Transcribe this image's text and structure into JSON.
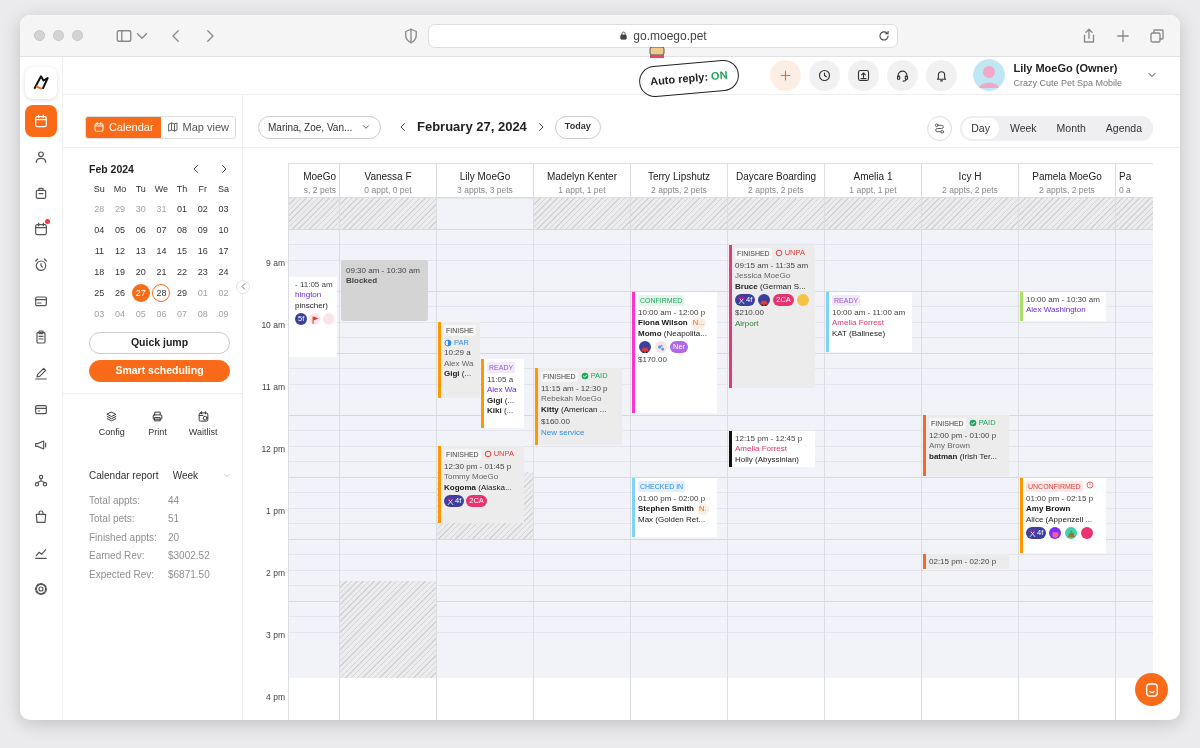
{
  "browser": {
    "url": "go.moego.pet"
  },
  "nav": {
    "items": [
      {
        "selected": true,
        "alert": false
      },
      {
        "selected": false,
        "alert": false
      },
      {
        "selected": false,
        "alert": false
      },
      {
        "selected": false,
        "alert": true
      },
      {
        "selected": false,
        "alert": false
      },
      {
        "selected": false,
        "alert": false
      },
      {
        "selected": false,
        "alert": false
      },
      {
        "selected": false,
        "alert": false
      },
      {
        "selected": false,
        "alert": false
      },
      {
        "selected": false,
        "alert": false
      },
      {
        "selected": false,
        "alert": false
      },
      {
        "selected": false,
        "alert": false
      },
      {
        "selected": false,
        "alert": false
      },
      {
        "selected": false,
        "alert": false
      }
    ]
  },
  "header": {
    "auto_reply": {
      "label": "Auto reply:",
      "state": "ON"
    },
    "actions": [
      {
        "accent": true
      },
      {
        "accent": false
      },
      {
        "accent": false
      },
      {
        "accent": false
      },
      {
        "accent": false
      }
    ],
    "user": {
      "name": "Lily MoeGo (Owner)",
      "business": "Crazy Cute Pet Spa Mobile"
    }
  },
  "sidebar": {
    "view_toggle": [
      {
        "label": "Calendar",
        "selected": true
      },
      {
        "label": "Map view",
        "selected": false
      }
    ],
    "mini_calendar": {
      "title": "Feb 2024",
      "weekdays": [
        "Su",
        "Mo",
        "Tu",
        "We",
        "Th",
        "Fr",
        "Sa"
      ],
      "weeks": [
        [
          {
            "day": "28",
            "outside": true,
            "selected": false,
            "today": false
          },
          {
            "day": "29",
            "outside": true,
            "selected": false,
            "today": false
          },
          {
            "day": "30",
            "outside": true,
            "selected": false,
            "today": false
          },
          {
            "day": "31",
            "outside": true,
            "selected": false,
            "today": false
          },
          {
            "day": "01",
            "outside": false,
            "selected": false,
            "today": false
          },
          {
            "day": "02",
            "outside": false,
            "selected": false,
            "today": false
          },
          {
            "day": "03",
            "outside": false,
            "selected": false,
            "today": false
          }
        ],
        [
          {
            "day": "04",
            "outside": false,
            "selected": false,
            "today": false
          },
          {
            "day": "05",
            "outside": false,
            "selected": false,
            "today": false
          },
          {
            "day": "06",
            "outside": false,
            "selected": false,
            "today": false
          },
          {
            "day": "07",
            "outside": false,
            "selected": false,
            "today": false
          },
          {
            "day": "08",
            "outside": false,
            "selected": false,
            "today": false
          },
          {
            "day": "09",
            "outside": false,
            "selected": false,
            "today": false
          },
          {
            "day": "10",
            "outside": false,
            "selected": false,
            "today": false
          }
        ],
        [
          {
            "day": "11",
            "outside": false,
            "selected": false,
            "today": false
          },
          {
            "day": "12",
            "outside": false,
            "selected": false,
            "today": false
          },
          {
            "day": "13",
            "outside": false,
            "selected": false,
            "today": false
          },
          {
            "day": "14",
            "outside": false,
            "selected": false,
            "today": false
          },
          {
            "day": "15",
            "outside": false,
            "selected": false,
            "today": false
          },
          {
            "day": "16",
            "outside": false,
            "selected": false,
            "today": false
          },
          {
            "day": "17",
            "outside": false,
            "selected": false,
            "today": false
          }
        ],
        [
          {
            "day": "18",
            "outside": false,
            "selected": false,
            "today": false
          },
          {
            "day": "19",
            "outside": false,
            "selected": false,
            "today": false
          },
          {
            "day": "20",
            "outside": false,
            "selected": false,
            "today": false
          },
          {
            "day": "21",
            "outside": false,
            "selected": false,
            "today": false
          },
          {
            "day": "22",
            "outside": false,
            "selected": false,
            "today": false
          },
          {
            "day": "23",
            "outside": false,
            "selected": false,
            "today": false
          },
          {
            "day": "24",
            "outside": false,
            "selected": false,
            "today": false
          }
        ],
        [
          {
            "day": "25",
            "outside": false,
            "selected": false,
            "today": false
          },
          {
            "day": "26",
            "outside": false,
            "selected": false,
            "today": false
          },
          {
            "day": "27",
            "outside": false,
            "selected": true,
            "today": false
          },
          {
            "day": "28",
            "outside": false,
            "selected": false,
            "today": true
          },
          {
            "day": "29",
            "outside": false,
            "selected": false,
            "today": false
          },
          {
            "day": "01",
            "outside": true,
            "selected": false,
            "today": false
          },
          {
            "day": "02",
            "outside": true,
            "selected": false,
            "today": false
          }
        ],
        [
          {
            "day": "03",
            "outside": true,
            "selected": false,
            "today": false
          },
          {
            "day": "04",
            "outside": true,
            "selected": false,
            "today": false
          },
          {
            "day": "05",
            "outside": true,
            "selected": false,
            "today": false
          },
          {
            "day": "06",
            "outside": true,
            "selected": false,
            "today": false
          },
          {
            "day": "07",
            "outside": true,
            "selected": false,
            "today": false
          },
          {
            "day": "08",
            "outside": true,
            "selected": false,
            "today": false
          },
          {
            "day": "09",
            "outside": true,
            "selected": false,
            "today": false
          }
        ]
      ]
    },
    "buttons": [
      {
        "label": "Quick jump",
        "primary": false
      },
      {
        "label": "Smart scheduling",
        "primary": true
      }
    ],
    "tools": [
      {
        "label": "Config"
      },
      {
        "label": "Print"
      },
      {
        "label": "Waitlist"
      }
    ],
    "report": {
      "title": "Calendar report",
      "period": "Week",
      "rows": [
        {
          "label": "Total appts:",
          "value": "44"
        },
        {
          "label": "Total pets:",
          "value": "51"
        },
        {
          "label": "Finished appts:",
          "value": "20"
        },
        {
          "label": "Earned Rev:",
          "value": "$3002.52"
        },
        {
          "label": "Expected Rev:",
          "value": "$6871.50"
        }
      ]
    }
  },
  "toolbar": {
    "staff_filter": "Marina, Zoe, Van...",
    "date": "February 27, 2024",
    "today": "Today",
    "views": [
      {
        "label": "Day",
        "selected": true
      },
      {
        "label": "Week",
        "selected": false
      },
      {
        "label": "Month",
        "selected": false
      },
      {
        "label": "Agenda",
        "selected": false
      }
    ]
  },
  "calendar": {
    "hours": [
      "9 am",
      "10 am",
      "11 am",
      "12 pm",
      "1 pm",
      "2 pm",
      "3 pm",
      "4 pm"
    ],
    "columns": [
      {
        "name": "MoeGo",
        "summary": "s, 2 pets",
        "unavailable": true
      },
      {
        "name": "Vanessa F",
        "summary": "0 appt, 0 pet",
        "unavailable": true
      },
      {
        "name": "Lily MoeGo",
        "summary": "3 appts, 3 pets",
        "unavailable": false
      },
      {
        "name": "Madelyn Kenter",
        "summary": "1 appt, 1 pet",
        "unavailable": true
      },
      {
        "name": "Terry Lipshutz",
        "summary": "2 appts, 2 pets",
        "unavailable": true
      },
      {
        "name": "Daycare Boarding",
        "summary": "2 appts, 2 pets",
        "unavailable": true
      },
      {
        "name": "Amelia 1",
        "summary": "1 appt, 1 pet",
        "unavailable": true
      },
      {
        "name": "Icy H",
        "summary": "2 appts, 2 pets",
        "unavailable": true
      },
      {
        "name": "Pamela MoeGo",
        "summary": "2 appts, 2 pets",
        "unavailable": true
      },
      {
        "name": "Pa",
        "summary": "0 a",
        "unavailable": true
      }
    ],
    "events": [
      {
        "kind": "appointment",
        "muted": false,
        "time": "- 11:05 am",
        "client": {
          "text": "hington",
          "kind": "link"
        },
        "pets": [
          "pinscher)"
        ],
        "badges": [
          {
            "kind": "label",
            "text": "5f",
            "color": "#3b3f9e"
          },
          {
            "kind": "flag",
            "color": "#fde2e7"
          },
          {
            "kind": "round",
            "color": "#fde2e7"
          }
        ]
      },
      {
        "kind": "blocked",
        "time": "09:30 am - 10:30 am",
        "title": "Blocked"
      },
      {
        "kind": "appointment",
        "color": "#ff9800",
        "muted": true,
        "status": {
          "text": "FINISHE",
          "kind": "finished"
        },
        "payment": {
          "kind": "partial",
          "text": "PAR"
        },
        "time": "10:29 a",
        "client": {
          "text": "Alex Wa",
          "kind": "muted"
        },
        "pets": [
          "**Gigi** (..."
        ]
      },
      {
        "kind": "appointment",
        "color": "#ff9800",
        "muted": false,
        "status": {
          "text": "READY",
          "kind": "ready"
        },
        "time": "11:05 a",
        "client": {
          "text": "Alex Wa",
          "kind": "link"
        },
        "pets": [
          "**Gigi** (...",
          "**Kiki** (..."
        ]
      },
      {
        "kind": "appointment",
        "color": "#ff9800",
        "muted": true,
        "status": {
          "text": "FINISHED",
          "kind": "finished"
        },
        "payment": {
          "kind": "unpaid",
          "text": "UNPA"
        },
        "time": "12:30 pm - 01:45 p",
        "client": {
          "text": "Tommy MoeGo",
          "kind": "muted"
        },
        "pets": [
          "**Kogoma** (Alaska..."
        ],
        "badges": [
          {
            "kind": "groom",
            "text": "4f",
            "color": "#3b3f9e"
          },
          {
            "kind": "label",
            "text": "2CA",
            "color": "#e8336f"
          }
        ]
      },
      {
        "kind": "appointment",
        "color": "#ff9800",
        "muted": true,
        "status": {
          "text": "FINISHED",
          "kind": "finished"
        },
        "payment": {
          "kind": "paid",
          "text": "PAID"
        },
        "time": "11:15 am - 12:30 p",
        "client": {
          "text": "Rebekah MoeGo",
          "kind": "muted"
        },
        "pets": [
          "**Kitty** (American ..."
        ],
        "price": "$160.00",
        "note": {
          "text": "New service",
          "kind": "service"
        }
      },
      {
        "kind": "appointment",
        "color": "#ff33cc",
        "muted": false,
        "status": {
          "text": "CONFIRMED",
          "kind": "confirmed"
        },
        "time": "10:00 am - 12:00 p",
        "client": {
          "text": "Fiona Wilson",
          "kind": "bold"
        },
        "tag": "N...",
        "pets": [
          "**Momo** (Neapolita..."
        ],
        "badges": [
          {
            "kind": "car",
            "color": "#3b3f9e"
          },
          {
            "kind": "bubbles",
            "color": "#fde2e7"
          },
          {
            "kind": "label",
            "text": "Ner",
            "color": "#b06ae8"
          }
        ],
        "price": "$170.00"
      },
      {
        "kind": "appointment",
        "color": "#7fd3f7",
        "muted": false,
        "status": {
          "text": "CHECKED IN",
          "kind": "checked-in"
        },
        "time": "01:00 pm - 02:00 p",
        "client": {
          "text": "Stephen Smith",
          "kind": "bold"
        },
        "tag": "N.",
        "pets": [
          "Max (Golden Ret..."
        ]
      },
      {
        "kind": "appointment",
        "color": "#e33b78",
        "muted": true,
        "status": {
          "text": "FINISHED",
          "kind": "finished"
        },
        "payment": {
          "kind": "unpaid",
          "text": "UNPA"
        },
        "time": "09:15 am - 11:35 am",
        "client": {
          "text": "Jessica MoeGo",
          "kind": "muted"
        },
        "pets": [
          "**Bruce** (German S..."
        ],
        "badges": [
          {
            "kind": "groom",
            "text": "4f",
            "color": "#3b3f9e"
          },
          {
            "kind": "car",
            "color": "#3b3f9e"
          },
          {
            "kind": "label",
            "text": "2CA",
            "color": "#e8336f"
          },
          {
            "kind": "round",
            "color": "#f5c242"
          }
        ],
        "price": "$210.00",
        "note": {
          "text": "Airport",
          "kind": "location"
        }
      },
      {
        "kind": "appointment",
        "color": "#111111",
        "muted": false,
        "time": "12:15 pm - 12:45 p",
        "client": {
          "text": "Amelia Forrest",
          "kind": "alert"
        },
        "pets": [
          "Holly (Abyssinian)"
        ]
      },
      {
        "kind": "appointment",
        "color": "#7fd3f7",
        "muted": false,
        "status": {
          "text": "READY",
          "kind": "ready"
        },
        "time": "10:00 am - 11:00 am",
        "client": {
          "text": "Amelia Forrest",
          "kind": "alert"
        },
        "pets": [
          "KAT (Balinese)"
        ]
      },
      {
        "kind": "appointment",
        "color": "#f06a2a",
        "muted": true,
        "status": {
          "text": "FINISHED",
          "kind": "finished"
        },
        "payment": {
          "kind": "paid",
          "text": "PAID"
        },
        "time": "12:00 pm - 01:00 p",
        "client": {
          "text": "Amy Brown",
          "kind": "muted"
        },
        "pets": [
          "**batman** (Irish Ter..."
        ]
      },
      {
        "kind": "appointment",
        "color": "#f06a2a",
        "muted": true,
        "time": "02:15 pm - 02:20 p"
      },
      {
        "kind": "appointment",
        "color": "#a8e06a",
        "muted": false,
        "time": "10:00 am - 10:30 am",
        "client": {
          "text": "Alex Washington",
          "kind": "link"
        }
      },
      {
        "kind": "appointment",
        "color": "#ff9800",
        "muted": false,
        "status": {
          "text": "UNCONFIRMED",
          "kind": "unconfirmed"
        },
        "payment": {
          "kind": "alert"
        },
        "time": "01:00 pm - 02:15 p",
        "client": {
          "text": "Amy Brown",
          "kind": "bold"
        },
        "pets": [
          "Alice (Appenzell ..."
        ],
        "badges": [
          {
            "kind": "groom",
            "text": "4f",
            "color": "#3b3f9e"
          },
          {
            "kind": "tongue",
            "color": "#7b2ff7"
          },
          {
            "kind": "moneybag",
            "color": "#43d1b0"
          },
          {
            "kind": "round",
            "color": "#e8336f"
          }
        ]
      },
      {
        "kind": "unavailable"
      },
      {
        "kind": "unavailable"
      }
    ]
  }
}
